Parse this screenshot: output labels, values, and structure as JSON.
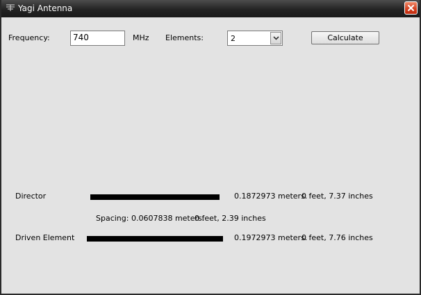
{
  "window": {
    "title": "Yagi Antenna",
    "icon": "antenna-icon",
    "close_icon": "close-icon",
    "close_color": "#d23d1c"
  },
  "form": {
    "frequency_label": "Frequency:",
    "frequency_value": "740",
    "frequency_unit": "MHz",
    "elements_label": "Elements:",
    "elements_value": "2",
    "calculate_label": "Calculate"
  },
  "results": {
    "director": {
      "label": "Director",
      "meters": "0.1872973 meters.",
      "imperial": "0 feet, 7.37 inches"
    },
    "spacing": {
      "meters": "Spacing: 0.0607838 meters.",
      "imperial": "0 feet, 2.39 inches"
    },
    "driven": {
      "label": "Driven Element",
      "meters": "0.1972973 meters.",
      "imperial": "0 feet, 7.76 inches"
    }
  }
}
